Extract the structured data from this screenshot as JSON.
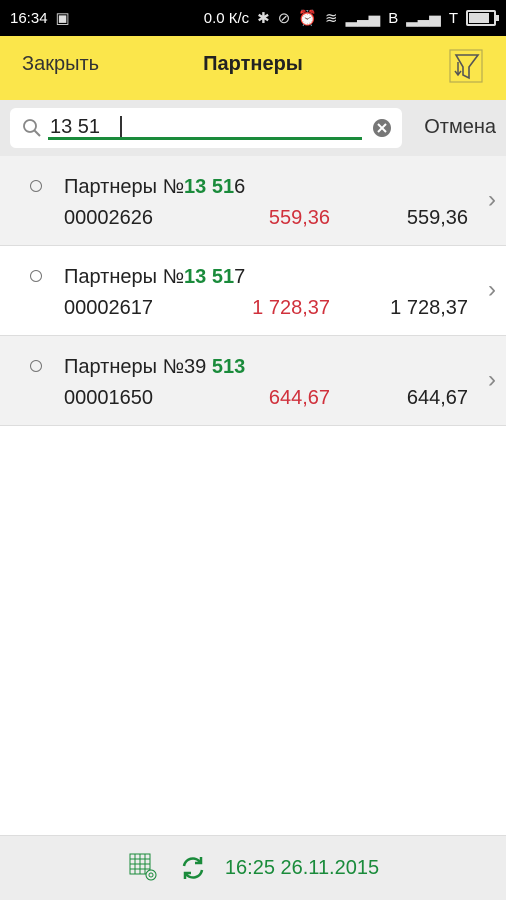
{
  "status_bar": {
    "time": "16:34",
    "speed": "0.0 К/с",
    "sim1": "B",
    "sim2": "T"
  },
  "header": {
    "close_label": "Закрыть",
    "title": "Партнеры",
    "filter_icon": "filter-icon"
  },
  "search": {
    "value": "13 51",
    "cancel_label": "Отмена"
  },
  "items": [
    {
      "name_prefix": "Партнеры №",
      "name_highlight": "13 51",
      "name_suffix": "6",
      "code": "00002626",
      "amount_red": "559,36",
      "amount": "559,36"
    },
    {
      "name_prefix": "Партнеры №",
      "name_highlight": "13 51",
      "name_suffix": "7",
      "code": "00002617",
      "amount_red": "1 728,37",
      "amount": "1 728,37"
    },
    {
      "name_prefix": "Партнеры №39 ",
      "name_highlight": "513",
      "name_suffix": "",
      "code": "00001650",
      "amount_red": "644,67",
      "amount": "644,67"
    }
  ],
  "footer": {
    "sync_time": "16:25 26.11.2015"
  },
  "colors": {
    "header_bg": "#FBE64B",
    "accent_green": "#1a8b3b",
    "amount_red": "#d0313c"
  }
}
